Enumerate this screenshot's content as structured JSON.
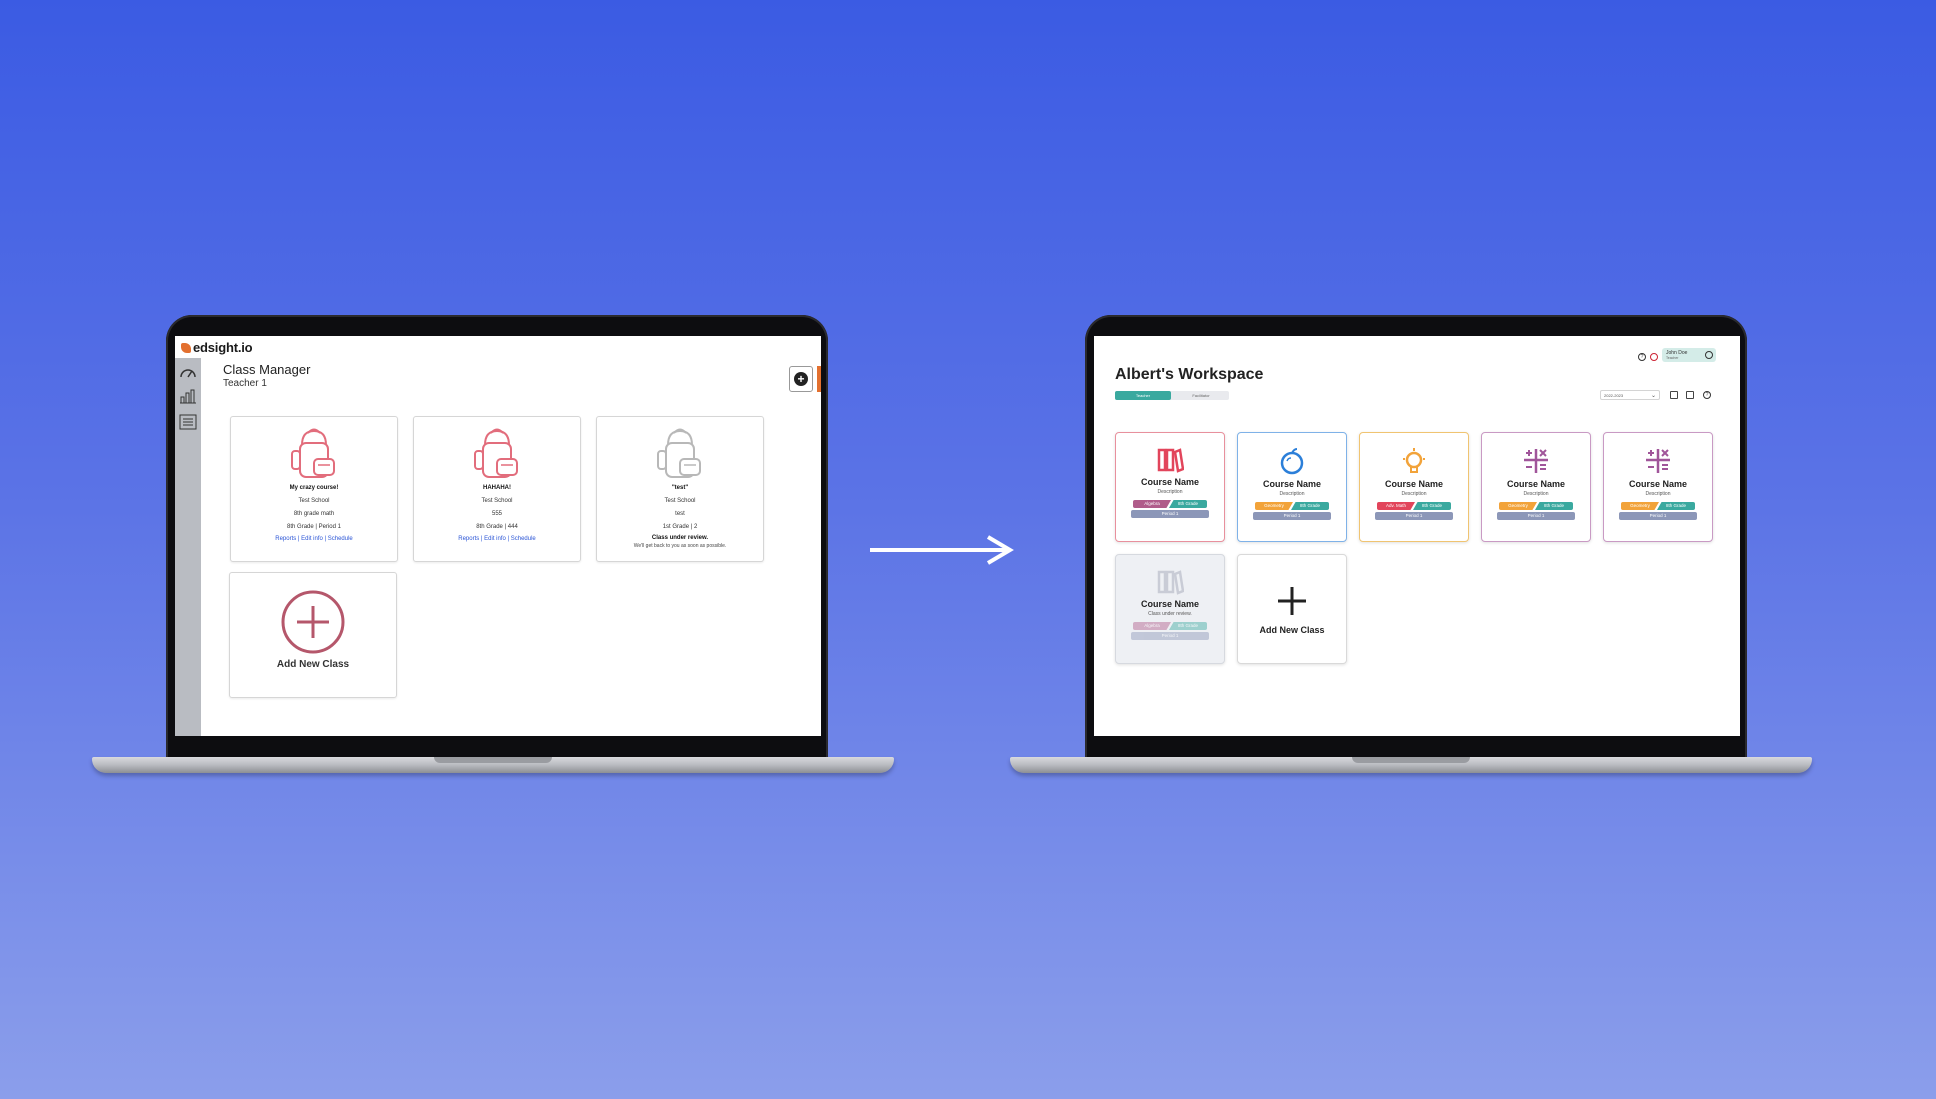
{
  "left_app": {
    "logo": "edsight.io",
    "title": "Class Manager",
    "subtitle": "Teacher 1",
    "cards": [
      {
        "name": "My crazy course!",
        "lines": [
          "Test School",
          "8th grade math",
          "8th Grade | Period 1"
        ],
        "links": "Reports | Edit info | Schedule",
        "color": "#e26d7c"
      },
      {
        "name": "HAHAHA!",
        "lines": [
          "Test School",
          "555",
          "8th Grade | 444"
        ],
        "links": "Reports | Edit info | Schedule",
        "color": "#e26d7c"
      },
      {
        "name": "\"test\"",
        "lines": [
          "Test School",
          "test",
          "1st Grade | 2"
        ],
        "review": "Class under review.",
        "note": "We'll get back to you as soon as possible.",
        "color": "#b8b8b8"
      }
    ],
    "add_label": "Add New Class",
    "add_color": "#b5576b"
  },
  "right_app": {
    "title": "Albert's Workspace",
    "tabs": [
      "Teacher",
      "Facilitator"
    ],
    "year": "2022-2023",
    "user_name": "John Doe",
    "user_role": "Teacher",
    "cards": [
      {
        "name": "Course Name",
        "desc": "Description",
        "tag1": "Algebra",
        "tag2": "8th Grade",
        "period": "Period 1",
        "border": "#e8909d",
        "icon": "books-icon",
        "iconColor": "#e2455b",
        "tag1Color": "#b05c8a",
        "tag2Color": "#3aa99f"
      },
      {
        "name": "Course Name",
        "desc": "Description",
        "tag1": "Geometry",
        "tag2": "8th Grade",
        "period": "Period 1",
        "border": "#7fb2e8",
        "icon": "apple-icon",
        "iconColor": "#2b7fd9",
        "tag1Color": "#f2a33a",
        "tag2Color": "#3aa99f"
      },
      {
        "name": "Course Name",
        "desc": "Description",
        "tag1": "Adv. Math",
        "tag2": "8th Grade",
        "period": "Period 1",
        "border": "#f0c471",
        "icon": "bulb-icon",
        "iconColor": "#f2a33a",
        "tag1Color": "#e2455b",
        "tag2Color": "#3aa99f"
      },
      {
        "name": "Course Name",
        "desc": "Description",
        "tag1": "Geometry",
        "tag2": "8th Grade",
        "period": "Period 1",
        "border": "#c99ac4",
        "icon": "math-icon",
        "iconColor": "#a0559a",
        "tag1Color": "#f2a33a",
        "tag2Color": "#3aa99f"
      },
      {
        "name": "Course Name",
        "desc": "Description",
        "tag1": "Geometry",
        "tag2": "8th Grade",
        "period": "Period 1",
        "border": "#c99ac4",
        "icon": "math-icon",
        "iconColor": "#a0559a",
        "tag1Color": "#f2a33a",
        "tag2Color": "#3aa99f"
      },
      {
        "name": "Course Name",
        "desc": "Class under review.",
        "tag1": "Algebra",
        "tag2": "8th Grade",
        "period": "Period 1",
        "border": "#d6d9df",
        "icon": "books-icon",
        "iconColor": "#c9ccd6",
        "tag1Color": "#b05c8a",
        "tag2Color": "#3aa99f"
      }
    ],
    "add_label": "Add New Class"
  }
}
